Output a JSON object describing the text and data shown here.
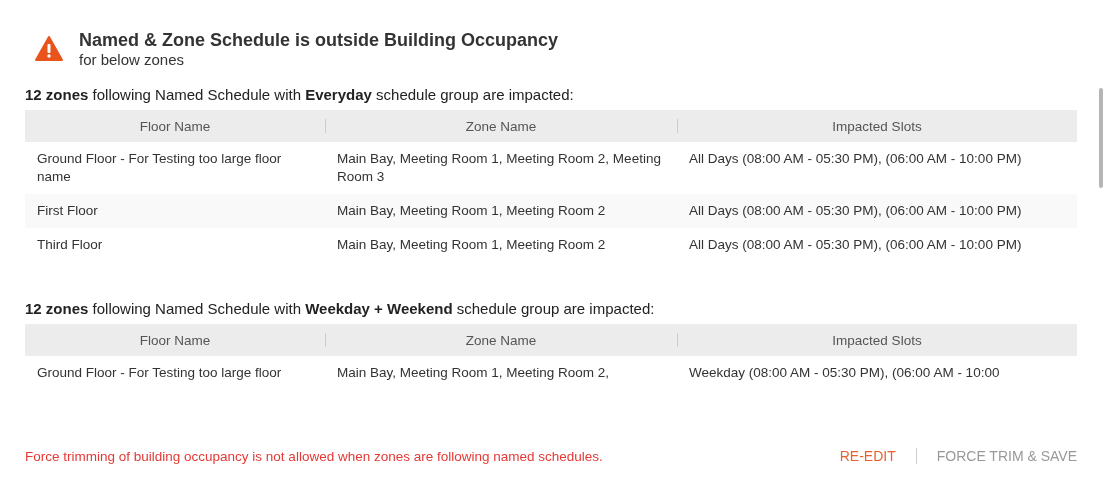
{
  "alert": {
    "title": "Named & Zone Schedule is outside Building Occupancy",
    "subtitle": "for below zones"
  },
  "groups": [
    {
      "heading": "**12 zones** following Named Schedule with **Everyday** schedule group are impacted:",
      "columns": [
        "Floor Name",
        "Zone Name",
        "Impacted Slots"
      ],
      "rows": [
        [
          "Ground Floor - For Testing too large floor name",
          "Main Bay, Meeting Room 1, Meeting Room 2, Meeting Room 3",
          "All Days (08:00 AM - 05:30 PM), (06:00 AM - 10:00 PM)"
        ],
        [
          "First Floor",
          "Main Bay, Meeting Room 1, Meeting Room 2",
          "All Days (08:00 AM - 05:30 PM), (06:00 AM - 10:00 PM)"
        ],
        [
          "Third Floor",
          "Main Bay, Meeting Room 1, Meeting Room 2",
          "All Days (08:00 AM - 05:30 PM), (06:00 AM - 10:00 PM)"
        ]
      ]
    },
    {
      "heading": "**12 zones** following Named Schedule with **Weekday + Weekend** schedule group are impacted:",
      "columns": [
        "Floor Name",
        "Zone Name",
        "Impacted Slots"
      ],
      "rows": [
        [
          "Ground Floor - For Testing too large floor",
          "Main Bay, Meeting Room 1, Meeting Room 2,",
          "Weekday (08:00 AM - 05:30 PM), (06:00 AM - 10:00"
        ]
      ]
    }
  ],
  "footer": {
    "error": "Force trimming of building occupancy is not allowed when zones are following named schedules.",
    "buttons": [
      {
        "label": "RE-EDIT",
        "kind": "primary"
      },
      {
        "label": "FORCE TRIM & SAVE",
        "kind": "muted"
      }
    ]
  }
}
